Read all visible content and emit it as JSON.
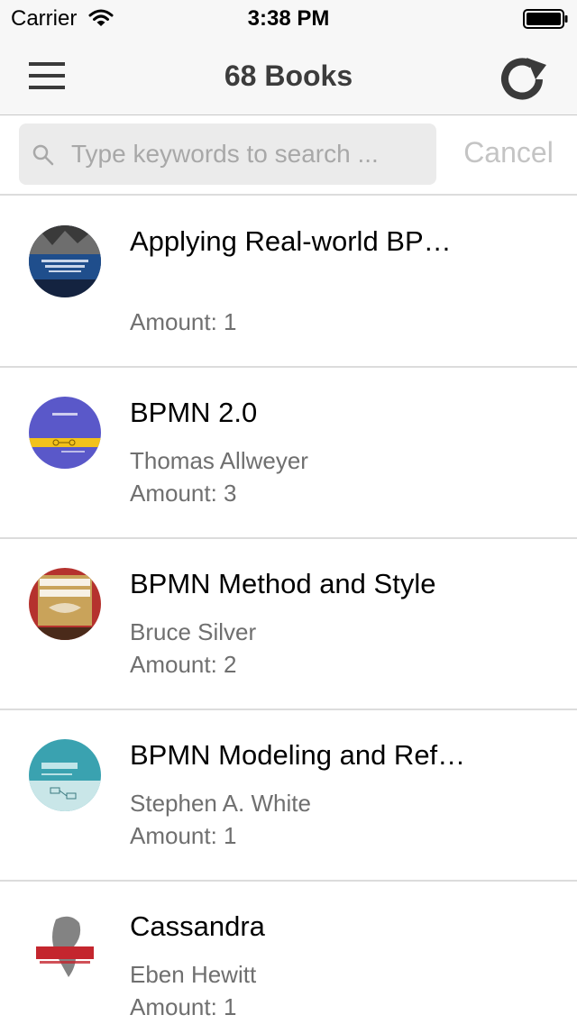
{
  "status_bar": {
    "carrier": "Carrier",
    "time": "3:38 PM",
    "wifi_icon": "wifi-icon",
    "battery_icon": "battery-icon"
  },
  "nav": {
    "title": "68 Books",
    "menu_icon": "hamburger-menu-icon",
    "refresh_icon": "refresh-icon"
  },
  "search": {
    "placeholder": "Type keywords to search ...",
    "value": "",
    "cancel_label": "Cancel",
    "icon": "search-icon"
  },
  "books": [
    {
      "title": "Applying Real-world BP…",
      "author": "",
      "amount": "Amount: 1",
      "cover_colors": [
        "#1b2b4a",
        "#2f5f9e"
      ]
    },
    {
      "title": "BPMN 2.0",
      "author": "Thomas Allweyer",
      "amount": "Amount: 3",
      "cover_colors": [
        "#5a58c9",
        "#f2c21b"
      ]
    },
    {
      "title": "BPMN Method and Style",
      "author": "Bruce Silver",
      "amount": "Amount: 2",
      "cover_colors": [
        "#b5322e",
        "#c9a35a"
      ]
    },
    {
      "title": "BPMN Modeling and Ref…",
      "author": "Stephen A. White",
      "amount": "Amount: 1",
      "cover_colors": [
        "#3aa2b0",
        "#c9e6e8"
      ]
    },
    {
      "title": "Cassandra",
      "author": "Eben Hewitt",
      "amount": "Amount: 1",
      "cover_colors": [
        "#ffffff",
        "#c4262e"
      ]
    }
  ],
  "colors": {
    "nav_background": "#f7f7f7",
    "title_text": "#3c3c3c",
    "secondary_text": "#6f6f6f",
    "cancel_text": "#c4c4c4",
    "separator": "#dcdcdc"
  }
}
